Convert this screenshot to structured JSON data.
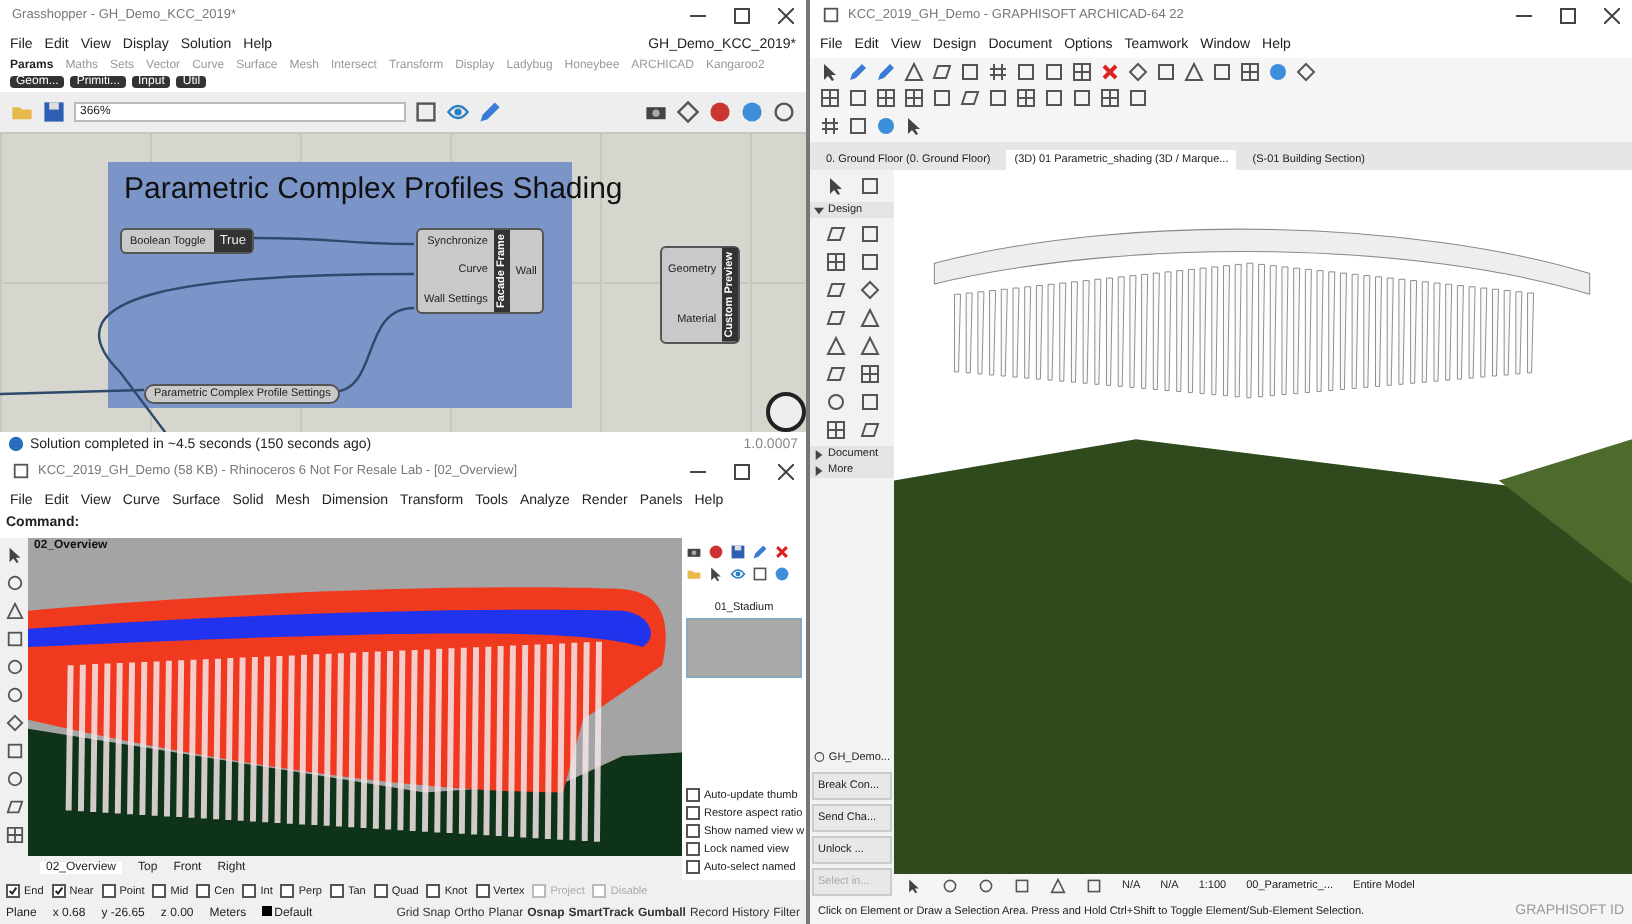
{
  "grasshopper": {
    "title": "Grasshopper - GH_Demo_KCC_2019*",
    "document_name": "GH_Demo_KCC_2019*",
    "menu": [
      "File",
      "Edit",
      "View",
      "Display",
      "Solution",
      "Help"
    ],
    "tabs": [
      {
        "label": "Params",
        "selected": true
      },
      {
        "label": "Maths",
        "selected": false
      },
      {
        "label": "Sets",
        "selected": false
      },
      {
        "label": "Vector",
        "selected": false
      },
      {
        "label": "Curve",
        "selected": false
      },
      {
        "label": "Surface",
        "selected": false
      },
      {
        "label": "Mesh",
        "selected": false
      },
      {
        "label": "Intersect",
        "selected": false
      },
      {
        "label": "Transform",
        "selected": false
      },
      {
        "label": "Display",
        "selected": false
      },
      {
        "label": "Ladybug",
        "selected": false
      },
      {
        "label": "Honeybee",
        "selected": false
      },
      {
        "label": "ARCHICAD",
        "selected": false
      },
      {
        "label": "Kangaroo2",
        "selected": false
      }
    ],
    "panels": [
      "Geom...",
      "Primiti...",
      "Input",
      "Util"
    ],
    "zoom": "366%",
    "group_title": "Parametric Complex Profiles Shading",
    "nodes": [
      {
        "kind": "toggle",
        "label": "Boolean Toggle",
        "value": "True"
      },
      {
        "kind": "component",
        "name": "Facade Frame",
        "inputs": [
          "Synchronize",
          "Curve",
          "Wall Settings"
        ],
        "outputs": [
          "Wall"
        ]
      },
      {
        "kind": "component",
        "name": "Custom Preview",
        "inputs": [
          "Geometry",
          "Material"
        ]
      },
      {
        "kind": "param",
        "label": "Parametric Complex Profile Settings"
      }
    ],
    "status": "Solution completed in ~4.5 seconds (150 seconds ago)",
    "version": "1.0.0007"
  },
  "rhino": {
    "title": "KCC_2019_GH_Demo (58 KB) - Rhinoceros 6 Not For Resale Lab - [02_Overview]",
    "menu": [
      "File",
      "Edit",
      "View",
      "Curve",
      "Surface",
      "Solid",
      "Mesh",
      "Dimension",
      "Transform",
      "Tools",
      "Analyze",
      "Render",
      "Panels",
      "Help"
    ],
    "command": "Command:",
    "viewport_title": "02_Overview",
    "viewport_tabs": [
      {
        "label": "02_Overview",
        "selected": true
      },
      {
        "label": "Top",
        "selected": false
      },
      {
        "label": "Front",
        "selected": false
      },
      {
        "label": "Right",
        "selected": false
      }
    ],
    "named_view": "01_Stadium",
    "view_options": [
      {
        "label": "Auto-update thumb",
        "checked": false
      },
      {
        "label": "Restore aspect ratio",
        "checked": false
      },
      {
        "label": "Show named view w",
        "checked": false
      },
      {
        "label": "Lock named view",
        "checked": false
      },
      {
        "label": "Auto-select named",
        "checked": false
      }
    ],
    "osnaps": [
      {
        "label": "End",
        "checked": true,
        "disabled": false
      },
      {
        "label": "Near",
        "checked": true,
        "disabled": false
      },
      {
        "label": "Point",
        "checked": false,
        "disabled": false
      },
      {
        "label": "Mid",
        "checked": false,
        "disabled": false
      },
      {
        "label": "Cen",
        "checked": false,
        "disabled": false
      },
      {
        "label": "Int",
        "checked": false,
        "disabled": false
      },
      {
        "label": "Perp",
        "checked": false,
        "disabled": false
      },
      {
        "label": "Tan",
        "checked": false,
        "disabled": false
      },
      {
        "label": "Quad",
        "checked": false,
        "disabled": false
      },
      {
        "label": "Knot",
        "checked": false,
        "disabled": false
      },
      {
        "label": "Vertex",
        "checked": false,
        "disabled": false
      },
      {
        "label": "Project",
        "checked": false,
        "disabled": true
      },
      {
        "label": "Disable",
        "checked": false,
        "disabled": true
      }
    ],
    "coordinates": [
      "Plane",
      "x 0.68",
      "y -26.65",
      "z 0.00",
      "Meters"
    ],
    "layer": "Default",
    "toggles": [
      {
        "label": "Grid Snap",
        "on": false
      },
      {
        "label": "Ortho",
        "on": false
      },
      {
        "label": "Planar",
        "on": false
      },
      {
        "label": "Osnap",
        "on": true
      },
      {
        "label": "SmartTrack",
        "on": true
      },
      {
        "label": "Gumball",
        "on": true
      },
      {
        "label": "Record History",
        "on": false
      },
      {
        "label": "Filter",
        "on": false
      }
    ]
  },
  "archicad": {
    "title": "KCC_2019_GH_Demo - GRAPHISOFT ARCHICAD-64 22",
    "menu": [
      "File",
      "Edit",
      "View",
      "Design",
      "Document",
      "Options",
      "Teamwork",
      "Window",
      "Help"
    ],
    "tabs": [
      {
        "label": "0. Ground Floor (0. Ground Floor)",
        "selected": false
      },
      {
        "label": "(3D) 01 Parametric_shading (3D / Marque...",
        "selected": true
      },
      {
        "label": "(S-01 Building Section)",
        "selected": false
      }
    ],
    "sections": [
      {
        "label": "Design",
        "expanded": true
      },
      {
        "label": "Document",
        "expanded": false
      },
      {
        "label": "More",
        "expanded": false
      }
    ],
    "project": "GH_Demo...",
    "buttons": [
      {
        "label": "Break Con...",
        "disabled": false
      },
      {
        "label": "Send Cha...",
        "disabled": false
      },
      {
        "label": "Unlock ...",
        "disabled": false
      },
      {
        "label": "Select in...",
        "disabled": true
      }
    ],
    "view_bar": [
      "N/A",
      "N/A",
      "1:100",
      "00_Parametric_...",
      "Entire Model"
    ],
    "status": "Click on Element or Draw a Selection Area. Press and Hold Ctrl+Shift to Toggle Element/Sub-Element Selection.",
    "brand": "GRAPHISOFT ID"
  }
}
